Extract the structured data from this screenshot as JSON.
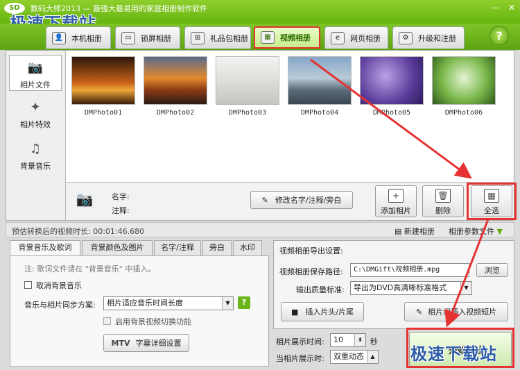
{
  "window": {
    "title": "数码大师2013 — 最强大最易用的家庭相册制作软件",
    "logo": "SD",
    "minimize": "—",
    "close": "✕"
  },
  "watermark": "极速下载站",
  "tabs": [
    "本机相册",
    "锁屏相册",
    "礼品包相册",
    "视频相册",
    "网页相册",
    "升级和注册"
  ],
  "help": "?",
  "sidebar": [
    "相片文件",
    "相片特效",
    "背景音乐"
  ],
  "photos": [
    "DMPhoto01",
    "DMPhoto02",
    "DMPhoto03",
    "DMPhoto04",
    "DMPhoto05",
    "DMPhoto06"
  ],
  "info": {
    "name_label": "名字:",
    "note_label": "注释:",
    "modify": "修改名字/注释/旁白",
    "add": "添加相片",
    "delete": "删除",
    "select_all": "全选"
  },
  "status": {
    "duration": "预估转换后的视频时长: 00:01:46.680",
    "new_album": "新建相册",
    "param_file": "相册参数文件"
  },
  "subtabs": [
    "背景音乐及歌词",
    "背景颜色及图片",
    "名字/注释",
    "旁白",
    "水印"
  ],
  "music": {
    "note": "注: 歌词文件请在 \"背景音乐\" 中插入。",
    "cancel": "取消背景音乐",
    "sync_label": "音乐与相片同步方案:",
    "sync_value": "相片适应音乐时间长度",
    "enable_switch": "启用背景视频切换功能",
    "mtv": "MTV",
    "subtitle": "字幕详细设置"
  },
  "export": {
    "heading": "视频相册导出设置:",
    "path_label": "视频相册保存路径:",
    "path": "C:\\DMGift\\视频相册.mpg",
    "browse": "浏览",
    "quality_label": "输出质量标准:",
    "quality": "导出为DVD高清晰标准格式",
    "insert_head": "插入片头/片尾",
    "insert_clip": "相片间插入视频短片"
  },
  "display": {
    "time_label": "相片展示时间:",
    "time": "10",
    "unit": "秒",
    "mode_label": "当相片展示时:",
    "mode": "双重动态"
  },
  "start": "开始导出"
}
